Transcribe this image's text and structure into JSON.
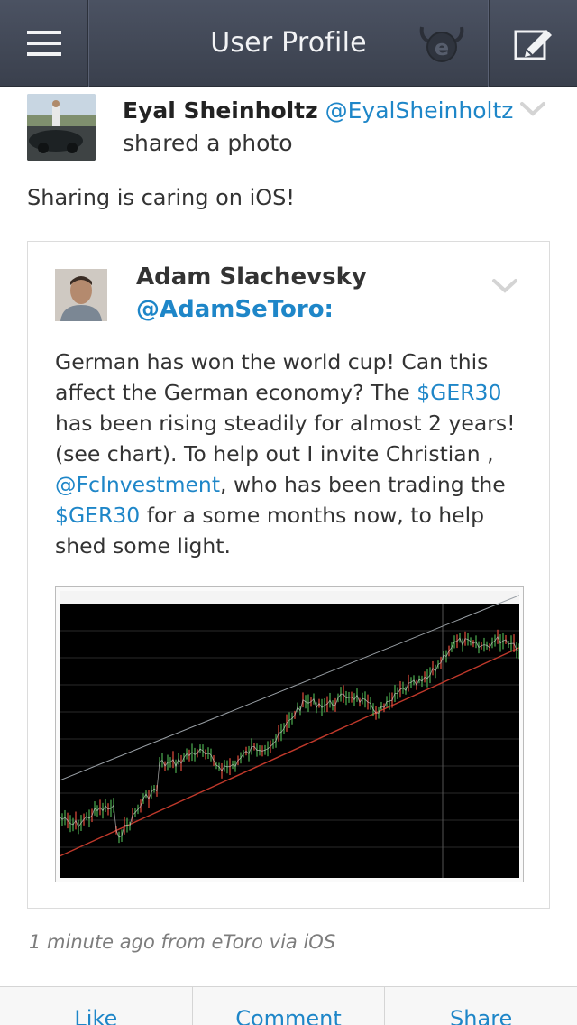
{
  "header": {
    "title": "User Profile",
    "menu_icon": "menu-icon",
    "logo": "etoro-logo",
    "compose_icon": "compose-icon"
  },
  "post": {
    "author_name": "Eyal Sheinholtz",
    "author_handle": "@EyalSheinholtz",
    "action_text": "shared a photo",
    "text": "Sharing is caring on iOS!",
    "timestamp": "1 minute ago from eToro via iOS"
  },
  "shared_post": {
    "author_name": "Adam Slachevsky",
    "author_handle": "@AdamSeToro:",
    "body": {
      "part1": "German has won the world cup! Can this affect the German economy? The ",
      "link1": "$GER30",
      "part2": " has been rising steadily for almost 2 years! (see chart). To help out I invite Christian , ",
      "link2": "@FcInvestment",
      "part3": ", who has been trading the ",
      "link3": "$GER30",
      "part4": " for a some months now, to help shed some light."
    }
  },
  "actions": {
    "like": "Like",
    "comment": "Comment",
    "share": "Share"
  },
  "colors": {
    "link": "#1e86c8",
    "navbar": "#434958",
    "chart_background": "#000000",
    "upper_channel": "#9aa0a6",
    "lower_channel": "#c0392b"
  }
}
